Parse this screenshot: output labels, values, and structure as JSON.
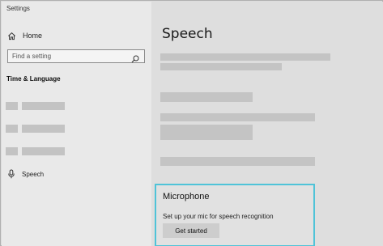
{
  "window": {
    "title": "Settings"
  },
  "sidebar": {
    "home_label": "Home",
    "search_placeholder": "Find a setting",
    "section_title": "Time & Language",
    "speech_label": "Speech"
  },
  "main": {
    "title": "Speech",
    "microphone": {
      "title": "Microphone",
      "description": "Set up your mic for speech recognition",
      "button_label": "Get started"
    }
  },
  "colors": {
    "sidebar_bg": "#e9e9e9",
    "main_bg": "#dedede",
    "focus_border": "#4fc3d8",
    "placeholder_gray": "#c4c4c4"
  },
  "icons": [
    "home-icon",
    "search-icon",
    "microphone-icon"
  ]
}
